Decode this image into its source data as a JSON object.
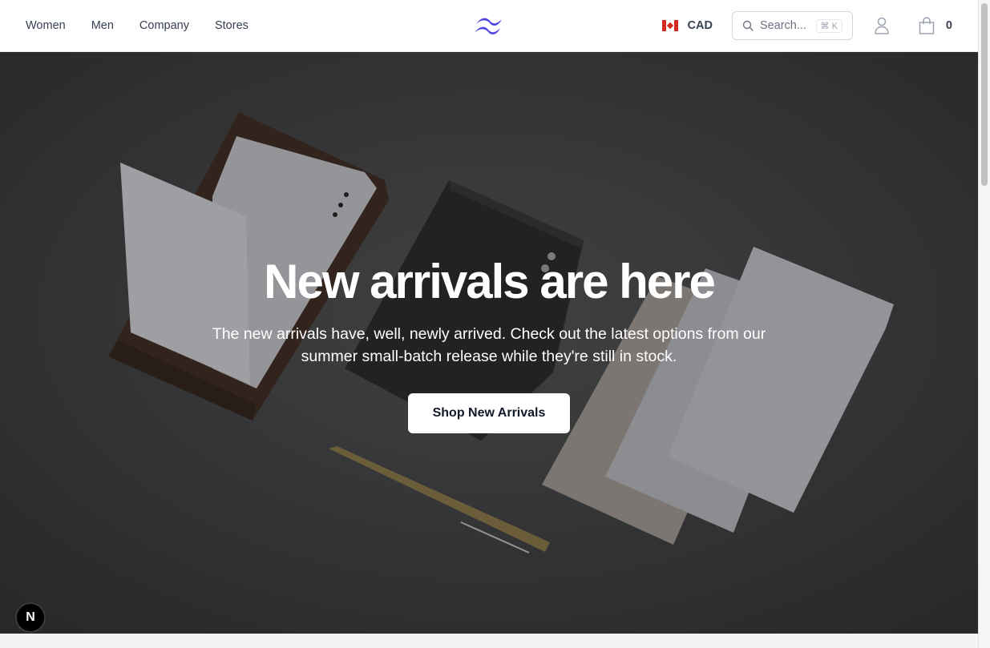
{
  "nav": {
    "items": [
      {
        "label": "Women"
      },
      {
        "label": "Men"
      },
      {
        "label": "Company"
      },
      {
        "label": "Stores"
      }
    ]
  },
  "header": {
    "currency": "CAD",
    "search_placeholder": "Search...",
    "search_shortcut": "⌘ K",
    "cart_count": "0"
  },
  "hero": {
    "title": "New arrivals are here",
    "subtitle": "The new arrivals have, well, newly arrived. Check out the latest options from our summer small-batch release while they're still in stock.",
    "cta_label": "Shop New Arrivals"
  },
  "badge": {
    "letter": "N"
  },
  "colors": {
    "brand": "#4f46e5",
    "hero_bg": "#3d3e3f",
    "text": "#374151"
  }
}
